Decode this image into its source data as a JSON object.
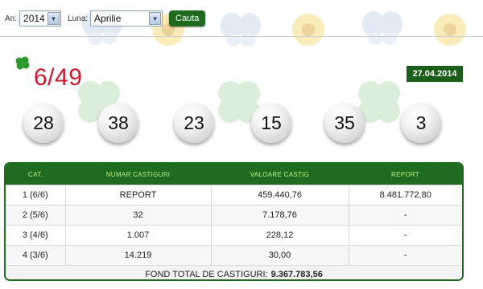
{
  "filters": {
    "year_label": "An:",
    "year_value": "2014",
    "month_label": "Luna:",
    "month_value": "Aprilie",
    "search_button": "Cauta"
  },
  "game": {
    "title": "6/49",
    "date": "27.04.2014"
  },
  "balls": [
    "28",
    "38",
    "23",
    "15",
    "35",
    "3"
  ],
  "table": {
    "headers": [
      "CAT.",
      "NUMAR CASTIGURI",
      "VALOARE CASTIG",
      "REPORT"
    ],
    "rows": [
      {
        "cat": "1 (6/6)",
        "count": "REPORT",
        "value": "459.440,76",
        "report": "8.481.772,80"
      },
      {
        "cat": "2 (5/6)",
        "count": "32",
        "value": "7.178,76",
        "report": "-"
      },
      {
        "cat": "3 (4/6)",
        "count": "1.007",
        "value": "228,12",
        "report": "-"
      },
      {
        "cat": "4 (3/6)",
        "count": "14.219",
        "value": "30,00",
        "report": "-"
      }
    ],
    "total_label": "FOND TOTAL DE CASTIGURI:",
    "total_value": "9.367.783,56"
  },
  "colors": {
    "accent_green": "#1f6b1f",
    "header_text": "#b9f08a",
    "title_red": "#d0182c"
  },
  "icons": [
    "clover-icon",
    "butterfly-decoration",
    "flower-decoration"
  ]
}
